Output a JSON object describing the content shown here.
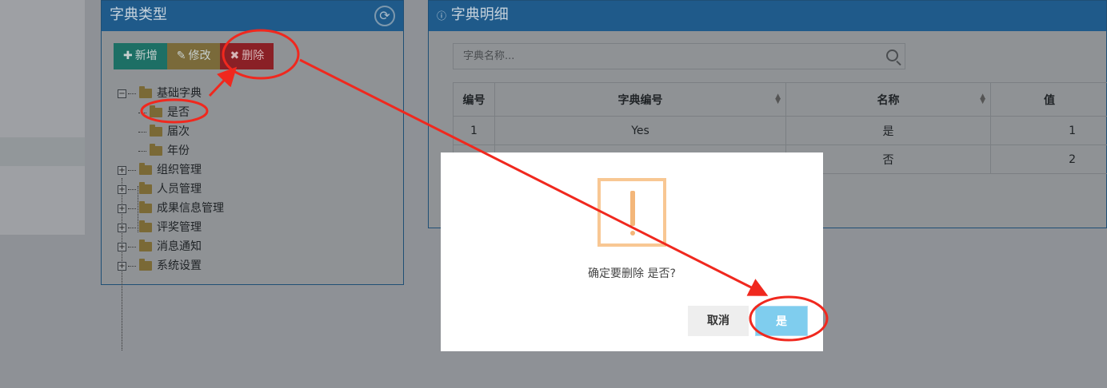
{
  "dict_type_panel": {
    "title": "字典类型",
    "buttons": {
      "add": "新增",
      "edit": "修改",
      "delete": "删除"
    },
    "tree": [
      {
        "label": "基础字典",
        "expanded": true,
        "children": [
          "是否",
          "届次",
          "年份"
        ]
      },
      {
        "label": "组织管理"
      },
      {
        "label": "人员管理"
      },
      {
        "label": "成果信息管理"
      },
      {
        "label": "评奖管理"
      },
      {
        "label": "消息通知"
      },
      {
        "label": "系统设置"
      }
    ]
  },
  "dict_detail_panel": {
    "title": "字典明细",
    "search_placeholder": "字典名称...",
    "table": {
      "headers": [
        "编号",
        "字典编号",
        "名称",
        "值"
      ],
      "rows": [
        [
          "1",
          "Yes",
          "是",
          "1"
        ],
        [
          "",
          "",
          "否",
          "2"
        ]
      ]
    }
  },
  "dialog": {
    "message": "确定要删除 是否?",
    "cancel": "取消",
    "confirm": "是"
  },
  "colors": {
    "annotation_red": "#f0281e",
    "confirm_blue": "#7fcdee",
    "warning_orange": "#f8c793"
  }
}
